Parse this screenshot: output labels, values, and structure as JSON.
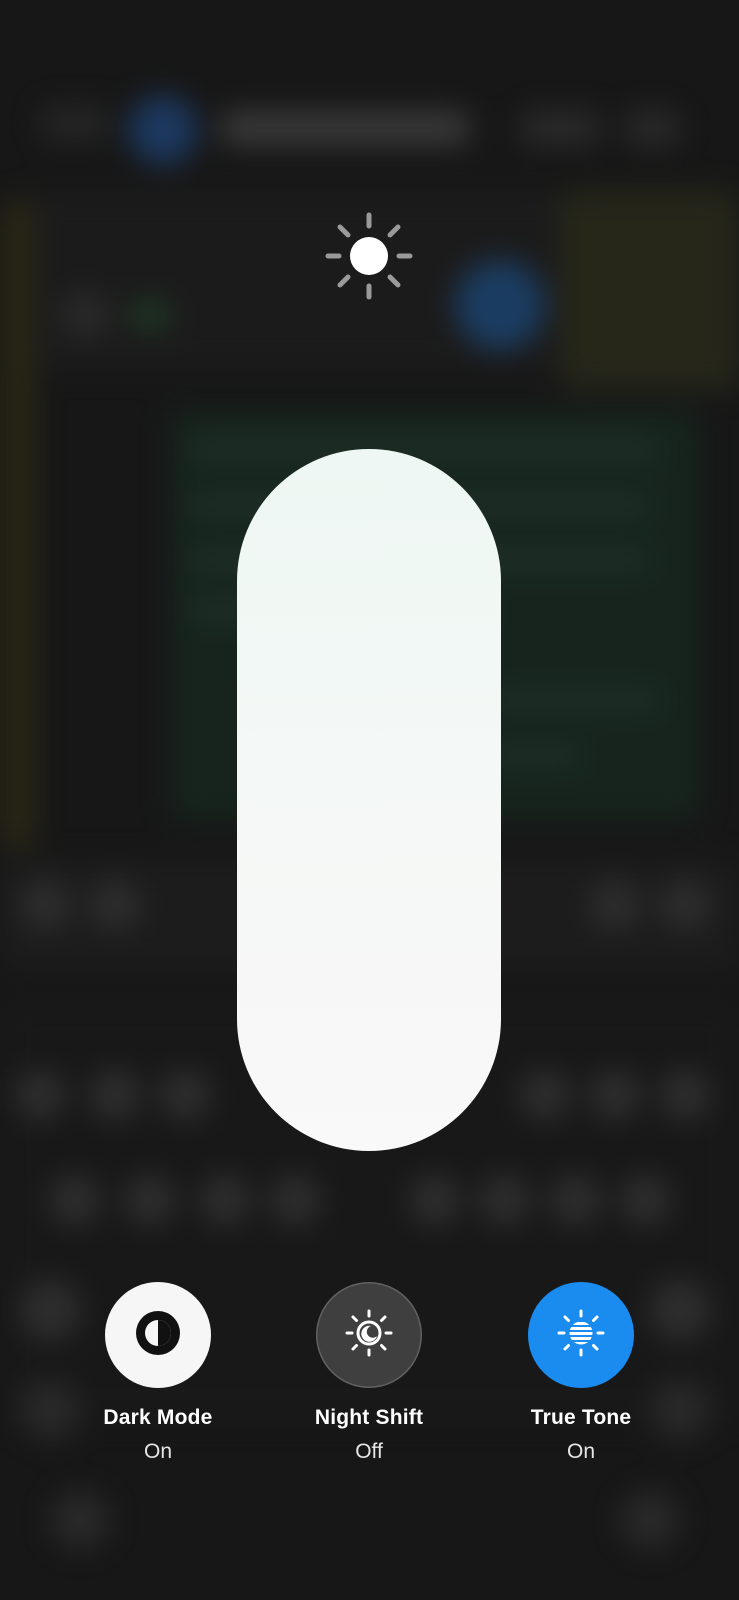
{
  "brightness": {
    "icon": "sun-icon",
    "level": 1.0,
    "fill_color": "#f6f8f7"
  },
  "controls": [
    {
      "label": "Dark Mode",
      "state": "On",
      "icon": "dark-mode-icon",
      "circle_color": "#f6f6f6"
    },
    {
      "label": "Night Shift",
      "state": "Off",
      "icon": "night-shift-icon",
      "circle_color": "#464646"
    },
    {
      "label": "True Tone",
      "state": "On",
      "icon": "true-tone-icon",
      "circle_color": "#1a8cf0"
    }
  ]
}
